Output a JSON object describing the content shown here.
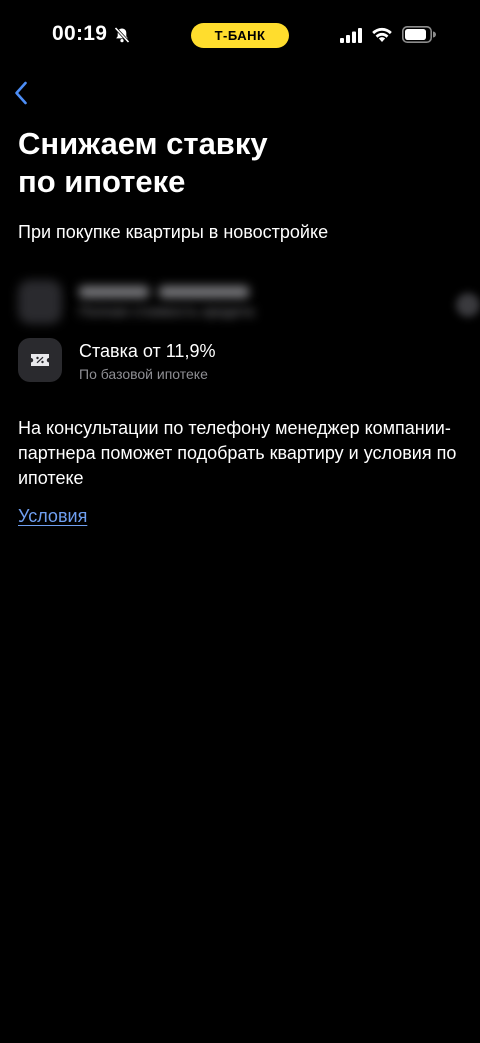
{
  "status_bar": {
    "time": "00:19",
    "bank_label": "Т-БАНК",
    "icons": [
      "bell-off-icon",
      "signal-icon",
      "wifi-icon",
      "battery-icon"
    ]
  },
  "header": {
    "back_icon": "chevron-left-icon"
  },
  "main": {
    "title": "Снижаем ставку\nпо ипотеке",
    "subtitle": "При покупке квартиры в новостройке",
    "features": [
      {
        "icon": "blurred-icon",
        "title": "",
        "caption": "Полная стоимость кредита"
      },
      {
        "icon": "percent-ticket-icon",
        "title": "Ставка от 11,9%",
        "caption": "По базовой ипотеке"
      }
    ],
    "description": "На консультации по телефону менеджер компании-партнера поможет подобрать квартиру и условия по ипотеке",
    "conditions_link": "Условия"
  },
  "colors": {
    "background": "#000000",
    "accent_yellow": "#ffdd2d",
    "link": "#6f9ff0",
    "secondary_text": "#8e8e93",
    "icon_tile": "#2a2a2e"
  }
}
